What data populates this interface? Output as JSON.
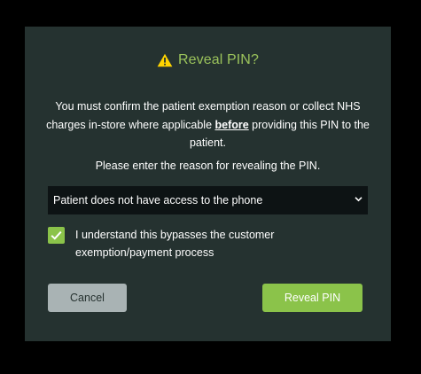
{
  "dialog": {
    "title": "Reveal PIN?",
    "message_part1": "You must confirm the patient exemption reason or collect NHS charges in-store where applicable ",
    "message_emphasis": "before",
    "message_part2": " providing this PIN to the patient.",
    "prompt": "Please enter the reason for revealing the PIN.",
    "reason_select": {
      "selected": "Patient does not have access to the phone"
    },
    "acknowledge": {
      "checked": true,
      "label": "I understand this bypasses the customer exemption/payment process"
    },
    "buttons": {
      "cancel": "Cancel",
      "reveal": "Reveal PIN"
    }
  },
  "colors": {
    "background": "#000000",
    "dialog": "#253230",
    "accent": "#8bc34a",
    "title": "#9bc35b",
    "warning": "#ffd400",
    "cancel_button": "#a9b3b4",
    "select_bg": "#0d1314"
  },
  "icons": {
    "title_icon": "warning-triangle-icon",
    "select_icon": "chevron-down-icon",
    "checkbox_icon": "check-icon"
  }
}
